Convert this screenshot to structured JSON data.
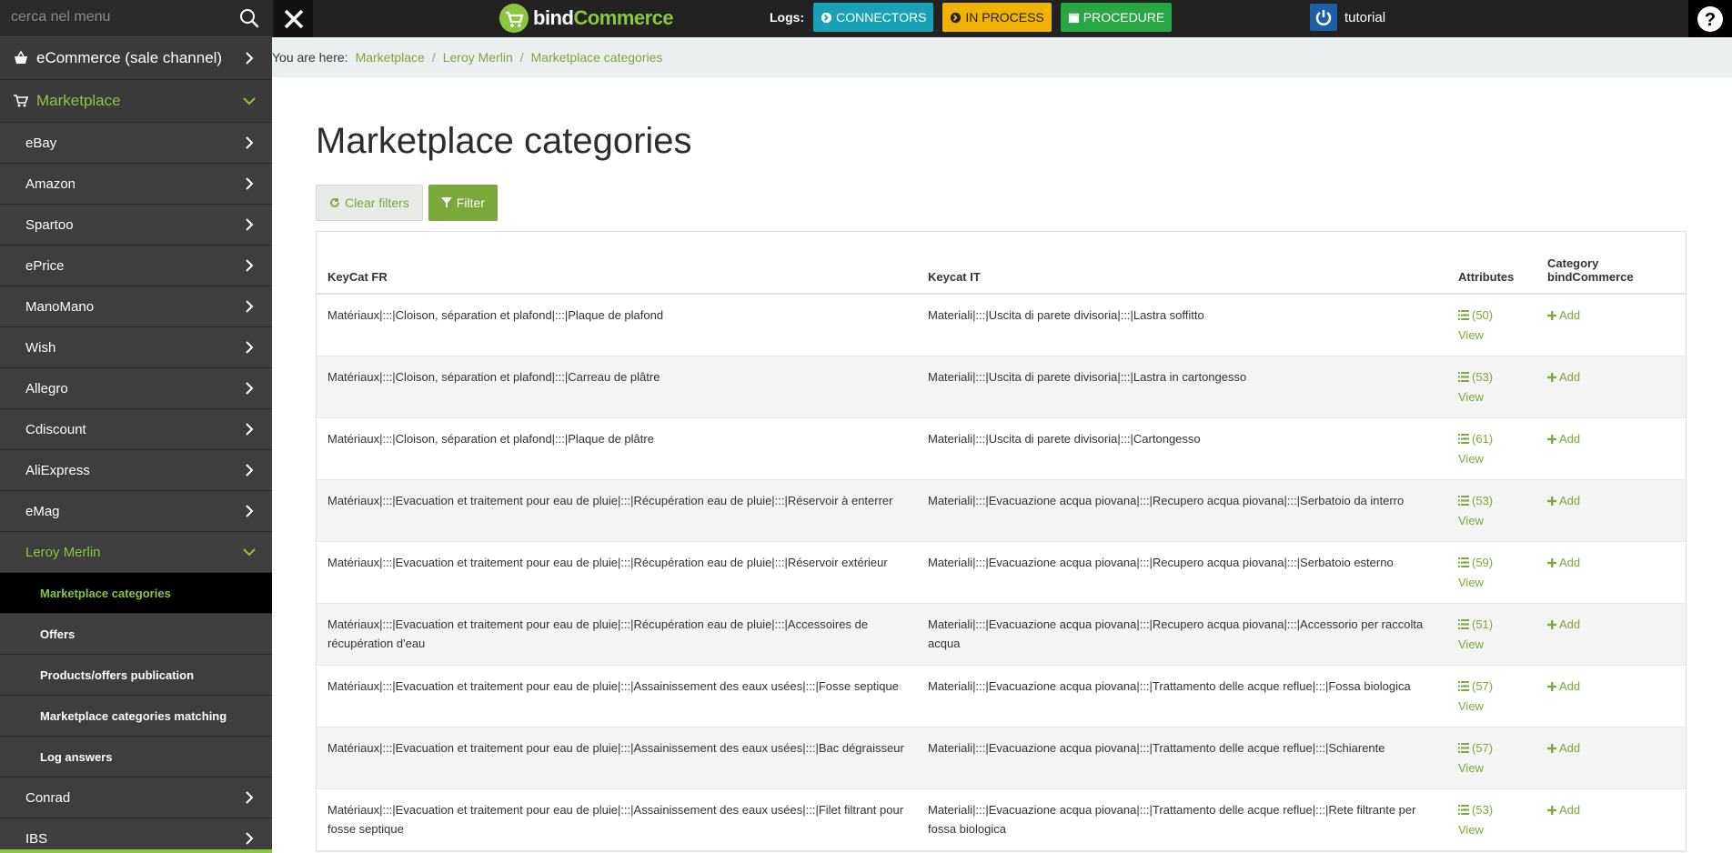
{
  "search": {
    "placeholder": "cerca nel menu"
  },
  "logo": {
    "part1": "bind",
    "part2": "Commerce"
  },
  "logs": {
    "label": "Logs:",
    "buttons": [
      {
        "label": "CONNECTORS"
      },
      {
        "label": "IN PROCESS"
      },
      {
        "label": "PROCEDURE"
      }
    ]
  },
  "user": {
    "name": "tutorial"
  },
  "sidebar": {
    "top_items": [
      {
        "label": "eCommerce (sale channel)"
      },
      {
        "label": "Marketplace"
      }
    ],
    "marketplaces": [
      {
        "label": "eBay"
      },
      {
        "label": "Amazon"
      },
      {
        "label": "Spartoo"
      },
      {
        "label": "ePrice"
      },
      {
        "label": "ManoMano"
      },
      {
        "label": "Wish"
      },
      {
        "label": "Allegro"
      },
      {
        "label": "Cdiscount"
      },
      {
        "label": "AliExpress"
      },
      {
        "label": "eMag"
      },
      {
        "label": "Leroy Merlin"
      }
    ],
    "leroy_sub": [
      {
        "label": "Marketplace categories"
      },
      {
        "label": "Offers"
      },
      {
        "label": "Products/offers publication"
      },
      {
        "label": "Marketplace categories matching"
      },
      {
        "label": "Log answers"
      }
    ],
    "after": [
      {
        "label": "Conrad"
      },
      {
        "label": "IBS"
      }
    ]
  },
  "breadcrumb": {
    "prefix": "You are here:",
    "items": [
      "Marketplace",
      "Leroy Merlin",
      "Marketplace categories"
    ]
  },
  "page": {
    "title": "Marketplace categories",
    "clear_label": "Clear filters",
    "filter_label": "Filter"
  },
  "table": {
    "headers": {
      "fr": "KeyCat FR",
      "it": "Keycat IT",
      "attributes": "Attributes",
      "category": "Category bindCommerce"
    },
    "view_label": "View",
    "add_label": "Add",
    "rows": [
      {
        "fr": "Matériaux|:::|Cloison, séparation et plafond|:::|Plaque de plafond",
        "it": "Materiali|:::|Uscita di parete divisoria|:::|Lastra soffitto",
        "count": "(50)"
      },
      {
        "fr": "Matériaux|:::|Cloison, séparation et plafond|:::|Carreau de plâtre",
        "it": "Materiali|:::|Uscita di parete divisoria|:::|Lastra in cartongesso",
        "count": "(53)"
      },
      {
        "fr": "Matériaux|:::|Cloison, séparation et plafond|:::|Plaque de plâtre",
        "it": "Materiali|:::|Uscita di parete divisoria|:::|Cartongesso",
        "count": "(61)"
      },
      {
        "fr": "Matériaux|:::|Evacuation et traitement pour eau de pluie|:::|Récupération eau de pluie|:::|Réservoir à enterrer",
        "it": "Materiali|:::|Evacuazione acqua piovana|:::|Recupero acqua piovana|:::|Serbatoio da interro",
        "count": "(53)"
      },
      {
        "fr": "Matériaux|:::|Evacuation et traitement pour eau de pluie|:::|Récupération eau de pluie|:::|Réservoir extérieur",
        "it": "Materiali|:::|Evacuazione acqua piovana|:::|Recupero acqua piovana|:::|Serbatoio esterno",
        "count": "(59)"
      },
      {
        "fr": "Matériaux|:::|Evacuation et traitement pour eau de pluie|:::|Récupération eau de pluie|:::|Accessoires de récupération d'eau",
        "it": "Materiali|:::|Evacuazione acqua piovana|:::|Recupero acqua piovana|:::|Accessorio per raccolta acqua",
        "count": "(51)"
      },
      {
        "fr": "Matériaux|:::|Evacuation et traitement pour eau de pluie|:::|Assainissement des eaux usées|:::|Fosse septique",
        "it": "Materiali|:::|Evacuazione acqua piovana|:::|Trattamento delle acque reflue|:::|Fossa biologica",
        "count": "(57)"
      },
      {
        "fr": "Matériaux|:::|Evacuation et traitement pour eau de pluie|:::|Assainissement des eaux usées|:::|Bac dégraisseur",
        "it": "Materiali|:::|Evacuazione acqua piovana|:::|Trattamento delle acque reflue|:::|Schiarente",
        "count": "(57)"
      },
      {
        "fr": "Matériaux|:::|Evacuation et traitement pour eau de pluie|:::|Assainissement des eaux usées|:::|Filet filtrant pour fosse septique",
        "it": "Materiali|:::|Evacuazione acqua piovana|:::|Trattamento delle acque reflue|:::|Rete filtrante per fossa biologica",
        "count": "(53)"
      }
    ]
  },
  "colors": {
    "accent": "#8cc63f",
    "link": "#7aa83a"
  }
}
